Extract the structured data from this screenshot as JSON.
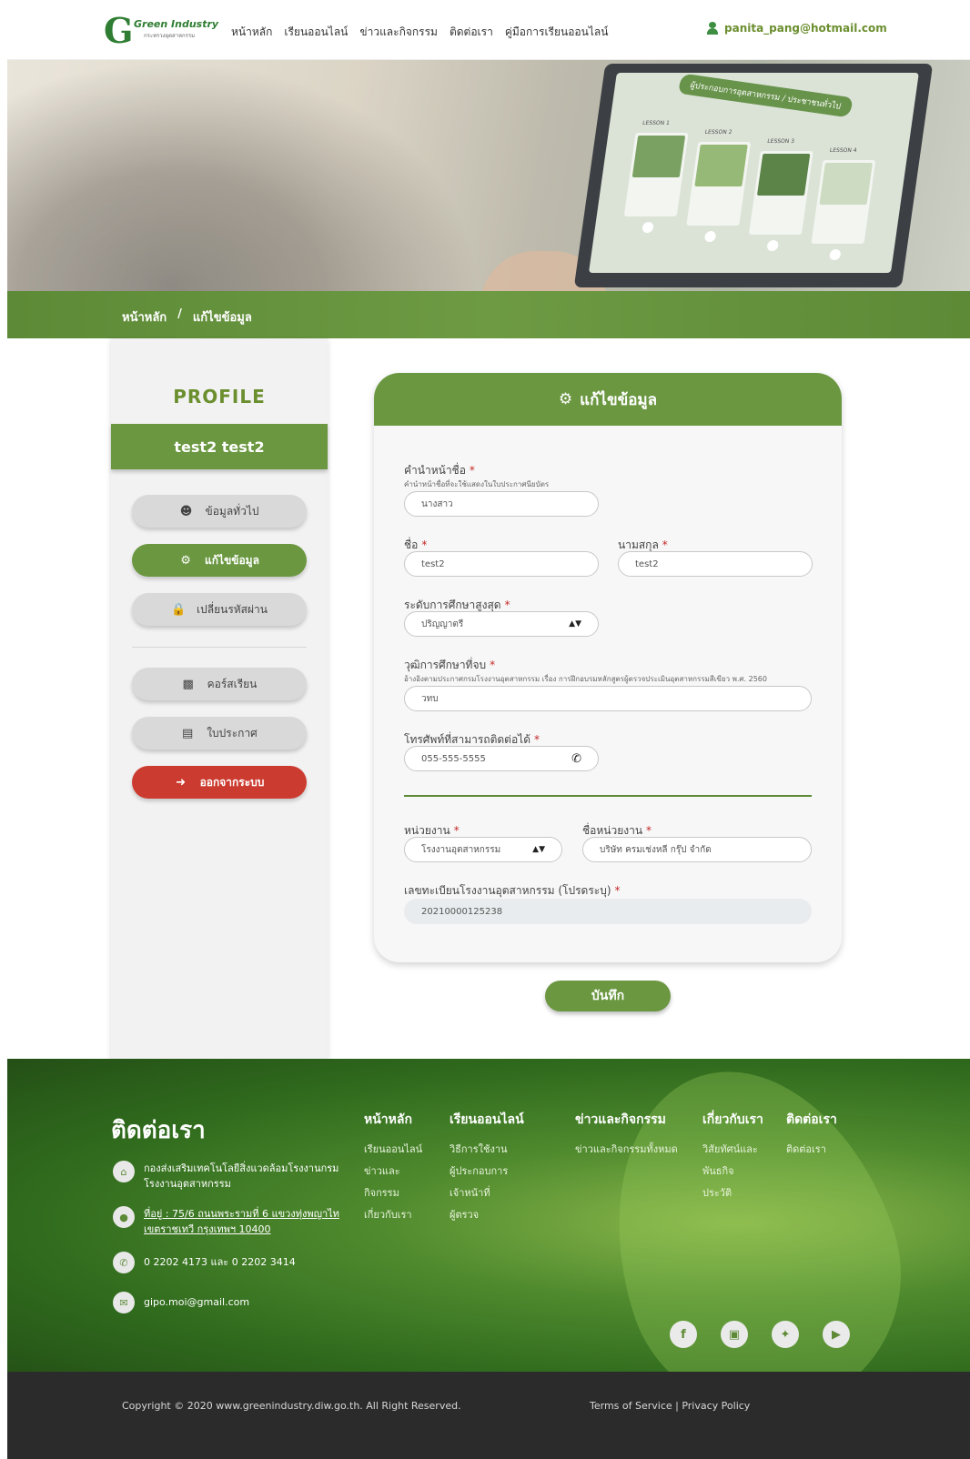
{
  "header": {
    "logo_text": "Green Industry",
    "logo_sub": "กระทรวงอุตสาหกรรม",
    "nav": [
      "หน้าหลัก",
      "เรียนออนไลน์",
      "ข่าวและกิจกรรม",
      "ติดต่อเรา",
      "คู่มือการเรียนออนไลน์"
    ],
    "user_email": "panita_pang@hotmail.com"
  },
  "hero": {
    "screen_title": "ผู้ประกอบการอุตสาหกรรม / ประชาชนทั่วไป",
    "lessons": [
      "LESSON 1",
      "LESSON 2",
      "LESSON 3",
      "LESSON 4"
    ]
  },
  "breadcrumb": {
    "home": "หน้าหลัก",
    "separator": "/",
    "current": "แก้ไขข้อมูล"
  },
  "sidebar": {
    "title": "PROFILE",
    "name": "test2  test2",
    "buttons": [
      {
        "label": "ข้อมูลทั่วไป",
        "icon": "user-icon"
      },
      {
        "label": "แก้ไขข้อมูล",
        "icon": "gear-icon"
      },
      {
        "label": "เปลี่ยนรหัสผ่าน",
        "icon": "lock-icon"
      },
      {
        "label": "คอร์สเรียน",
        "icon": "monitor-icon"
      },
      {
        "label": "ใบประกาศ",
        "icon": "certificate-icon"
      },
      {
        "label": "ออกจากระบบ",
        "icon": "logout-icon"
      }
    ]
  },
  "form": {
    "title": "แก้ไขข้อมูล",
    "prefix_label": "คำนำหน้าชื่อ",
    "prefix_hint": "คำนำหน้าชื่อที่จะใช้แสดงในใบประกาศนียบัตร",
    "prefix_value": "นางสาว",
    "firstname_label": "ชื่อ",
    "firstname_value": "test2",
    "lastname_label": "นามสกุล",
    "lastname_value": "test2",
    "education_label": "ระดับการศึกษาสูงสุด",
    "education_value": "ปริญญาตรี",
    "degree_label": "วุฒิการศึกษาที่จบ",
    "degree_hint": "อ้างอิงตามประกาศกรมโรงงานอุตสาหกรรม เรื่อง การฝึกอบรมหลักสูตรผู้ตรวจประเมินอุตสาหกรรมสีเขียว พ.ศ. 2560",
    "degree_value": "วทบ",
    "phone_label": "โทรศัพท์ที่สามารถติดต่อได้",
    "phone_value": "055-555-5555",
    "unit_label": "หน่วยงาน",
    "unit_value": "โรงงานอุตสาหกรรม",
    "unit_name_label": "ชื่อหน่วยงาน",
    "unit_name_value": "บริษัท ครมเช่งหลี กรุ๊ป จำกัด",
    "factory_reg_label": "เลขทะเบียนโรงงานอุตสาหกรรม (โปรดระบุ)",
    "factory_reg_value": "20210000125238",
    "required_mark": "*",
    "save_label": "บันทึก"
  },
  "footer": {
    "contact_title": "ติดต่อเรา",
    "org": "กองส่งเสริมเทคโนโลยีสิ่งแวดล้อมโรงงานกรม โรงงานอุตสาหกรรม",
    "address": "ที่อยู่ : 75/6 ถนนพระรามที่ 6 แขวงทุ่งพญาไท เขตราชเทวี กรุงเทพฯ 10400",
    "phone": "0 2202 4173 และ 0 2202 3414",
    "email": "gipo.moi@gmail.com",
    "columns": [
      {
        "heading": "หน้าหลัก",
        "items": [
          "เรียนออนไลน์",
          "ข่าวและ",
          "กิจกรรม",
          "เกี่ยวกับเรา"
        ]
      },
      {
        "heading": "เรียนออนไลน์",
        "items": [
          "วิธีการใช้งาน",
          "ผู้ประกอบการ",
          "เจ้าหน้าที่",
          "ผู้ตรวจ"
        ]
      },
      {
        "heading": "ข่าวและกิจกรรม",
        "items": [
          "ข่าวและกิจกรรมทั้งหมด"
        ]
      },
      {
        "heading": "เกี่ยวกับเรา",
        "items": [
          "วิสัยทัศน์และ",
          "พันธกิจ",
          "ประวัติ"
        ]
      },
      {
        "heading": "ติดต่อเรา",
        "items": [
          "ติดต่อเรา"
        ]
      }
    ],
    "social": [
      "facebook-icon",
      "instagram-icon",
      "twitter-icon",
      "youtube-icon"
    ],
    "copyright": "Copyright © 2020 www.greenindustry.diw.go.th. All Right Reserved.",
    "terms": "Terms of Service | Privacy Policy"
  }
}
